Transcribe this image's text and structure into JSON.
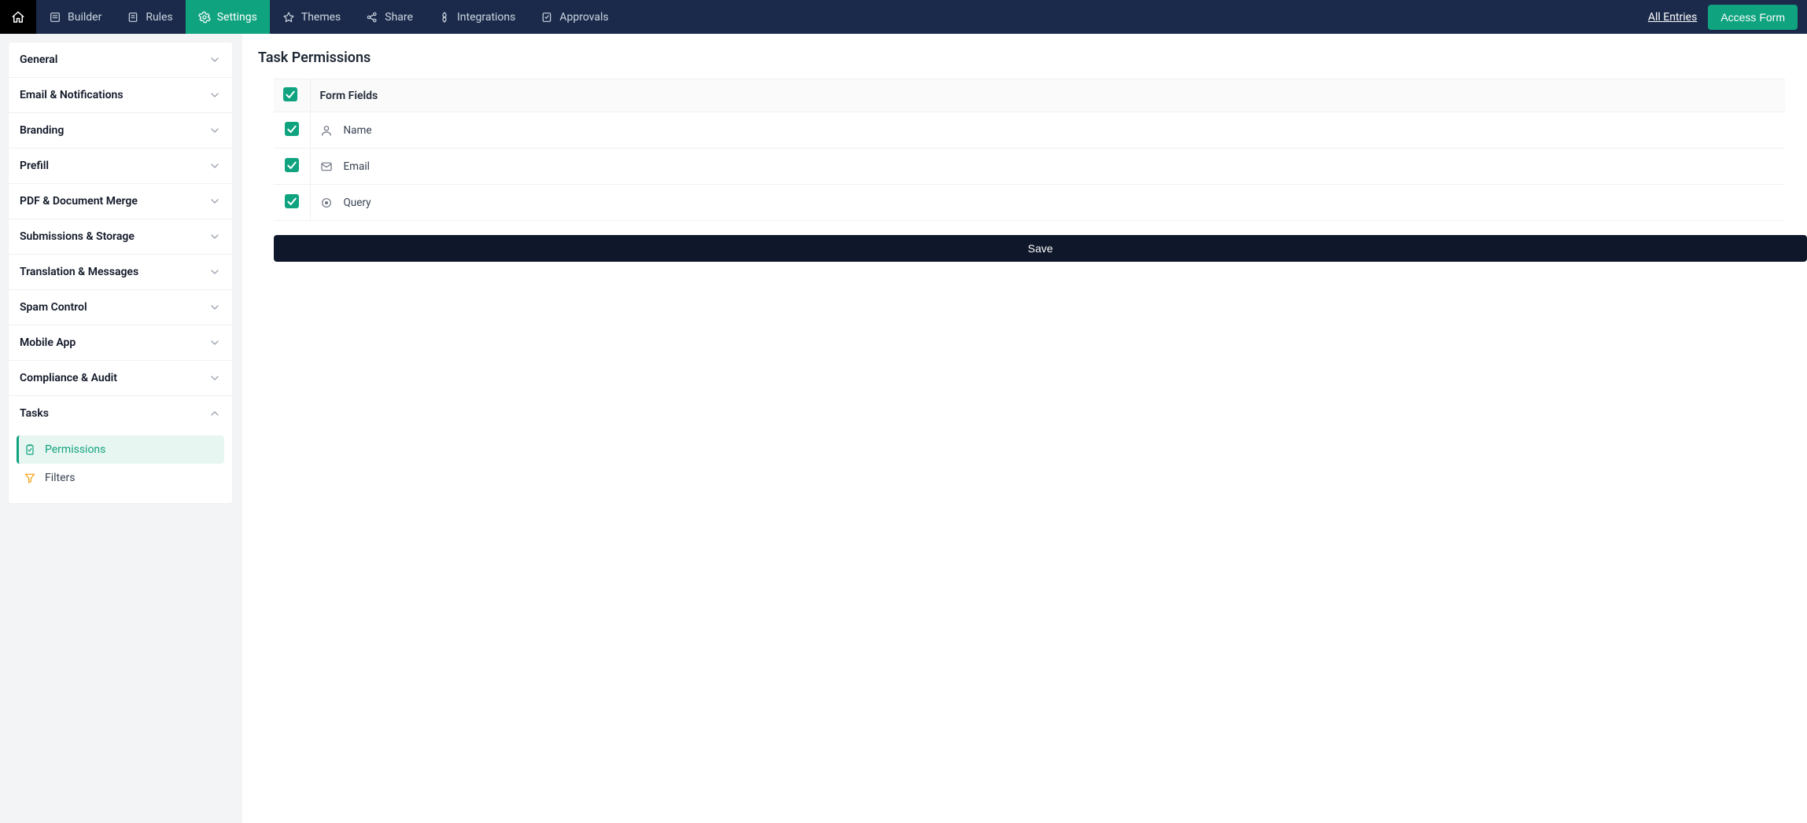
{
  "topnav": {
    "items": [
      {
        "id": "builder",
        "label": "Builder",
        "active": false
      },
      {
        "id": "rules",
        "label": "Rules",
        "active": false
      },
      {
        "id": "settings",
        "label": "Settings",
        "active": true
      },
      {
        "id": "themes",
        "label": "Themes",
        "active": false
      },
      {
        "id": "share",
        "label": "Share",
        "active": false
      },
      {
        "id": "integrations",
        "label": "Integrations",
        "active": false
      },
      {
        "id": "approvals",
        "label": "Approvals",
        "active": false
      }
    ],
    "all_entries_label": "All Entries",
    "access_form_label": "Access Form"
  },
  "sidebar": {
    "sections": [
      {
        "id": "general",
        "label": "General",
        "expanded": false
      },
      {
        "id": "email",
        "label": "Email & Notifications",
        "expanded": false
      },
      {
        "id": "branding",
        "label": "Branding",
        "expanded": false
      },
      {
        "id": "prefill",
        "label": "Prefill",
        "expanded": false
      },
      {
        "id": "pdf",
        "label": "PDF & Document Merge",
        "expanded": false
      },
      {
        "id": "submissions",
        "label": "Submissions & Storage",
        "expanded": false
      },
      {
        "id": "translation",
        "label": "Translation & Messages",
        "expanded": false
      },
      {
        "id": "spam",
        "label": "Spam Control",
        "expanded": false
      },
      {
        "id": "mobile",
        "label": "Mobile App",
        "expanded": false
      },
      {
        "id": "compliance",
        "label": "Compliance & Audit",
        "expanded": false
      },
      {
        "id": "tasks",
        "label": "Tasks",
        "expanded": true,
        "children": [
          {
            "id": "permissions",
            "label": "Permissions",
            "active": true
          },
          {
            "id": "filters",
            "label": "Filters",
            "active": false
          }
        ]
      }
    ]
  },
  "main": {
    "title": "Task Permissions",
    "table": {
      "header_checked": true,
      "header_label": "Form Fields",
      "rows": [
        {
          "id": "name",
          "label": "Name",
          "icon": "user",
          "checked": true
        },
        {
          "id": "email",
          "label": "Email",
          "icon": "mail",
          "checked": true
        },
        {
          "id": "query",
          "label": "Query",
          "icon": "radio",
          "checked": true
        }
      ]
    },
    "save_label": "Save"
  },
  "colors": {
    "accent": "#10a37f",
    "navBg": "#1b2a4a",
    "darkBtn": "#0f172a"
  }
}
